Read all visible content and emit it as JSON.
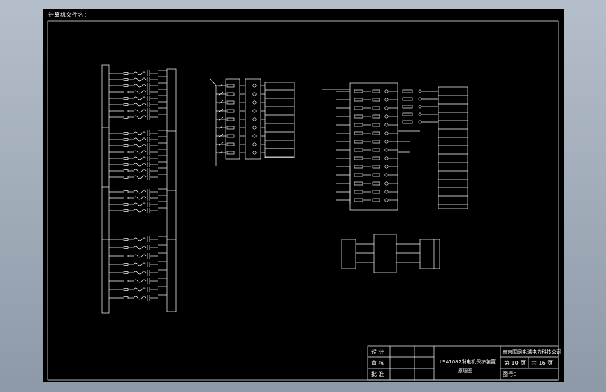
{
  "file_label": "计算机文件名：",
  "titleblock": {
    "design": "设 计",
    "review": "审 核",
    "approve": "批 准",
    "drawing_name_line1": "LSA1082发电机保护装置",
    "drawing_name_line2": "原理图",
    "company": "南京国网电瑞电力科技公司",
    "sheet": "第 10 页",
    "total": "共 16 页",
    "drawing_no": "图号："
  },
  "colors": {
    "canvas": "#000000",
    "lines": "#ffffff",
    "background": "#a3adbb"
  }
}
